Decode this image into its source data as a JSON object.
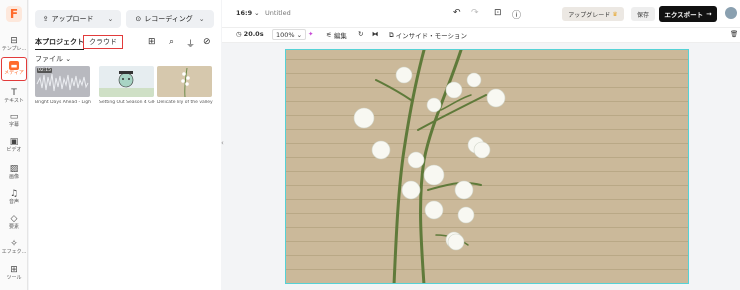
{
  "rail": {
    "logo": "F",
    "items": [
      {
        "icon": "template-icon",
        "label": "テンプレ..."
      },
      {
        "icon": "media-icon",
        "label": "メディア"
      },
      {
        "icon": "text-icon",
        "label": "テキスト"
      },
      {
        "icon": "caption-icon",
        "label": "字幕"
      },
      {
        "icon": "video-icon",
        "label": "ビデオ"
      },
      {
        "icon": "image-icon",
        "label": "画像"
      },
      {
        "icon": "audio-icon",
        "label": "音声"
      },
      {
        "icon": "element-icon",
        "label": "要素"
      },
      {
        "icon": "effect-icon",
        "label": "エフェク..."
      },
      {
        "icon": "tool-icon",
        "label": "ツール"
      }
    ]
  },
  "panel": {
    "upload_label": "アップロード",
    "record_label": "レコーディング",
    "tab_local": "本プロジェクト",
    "tab_cloud": "クラウド",
    "file_filter": "ファイル",
    "thumbnails": [
      {
        "label": "Bright Days Ahead - Light ...",
        "badge": "02:15"
      },
      {
        "label": "Setting Out Season 4 GIF ...",
        "badge": ""
      },
      {
        "label": "Delicate lily of the valley fl...",
        "badge": ""
      }
    ]
  },
  "topbar": {
    "aspect": "16:9",
    "title": "Untitled",
    "upgrade": "アップグレード",
    "save": "保存",
    "export": "エクスポート"
  },
  "toolbar": {
    "duration": "20.0s",
    "zoom": "100%",
    "edit": "編集",
    "inside_motion": "インサイド・モーション"
  },
  "colors": {
    "accent": "#ff6a2b",
    "highlight": "#e23b3b",
    "canvas_border": "#55d2d6"
  }
}
